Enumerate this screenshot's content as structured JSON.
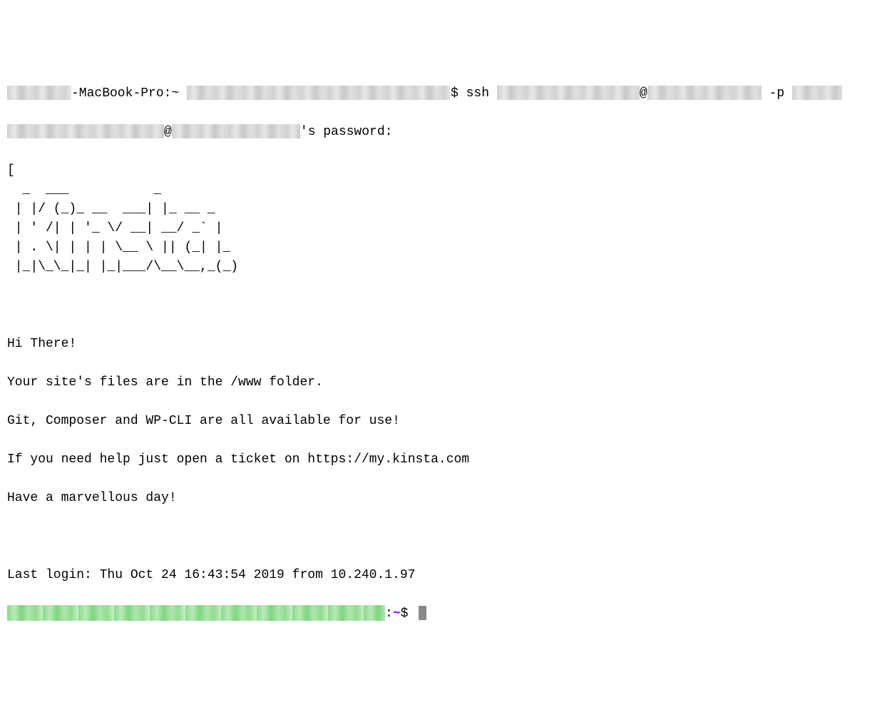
{
  "line1_p1": "-MacBook-Pro:~ ",
  "line1_p2": "$ ssh ",
  "line1_p3": "@",
  "line1_p4": " -p ",
  "line2_p1": "@",
  "line2_p2": "'s password:",
  "ascii_art": "[\n  _  ___           _\n | |/ (_)_ __  ___| |_ __ _\n | ' /| | '_ \\/ __| __/ _` |\n | . \\| | | | \\__ \\ || (_| |_\n |_|\\_\\_|_| |_|___/\\__\\__,_(_)",
  "motd_lines": [
    "Hi There!",
    "Your site's files are in the /www folder.",
    "Git, Composer and WP-CLI are all available for use!",
    "If you need help just open a ticket on https://my.kinsta.com",
    "Have a marvellous day!"
  ],
  "last_login": "Last login: Thu Oct 24 16:43:54 2019 from 10.240.1.97",
  "prompt_suffix": ":",
  "prompt_tilde": "~",
  "prompt_dollar": "$ "
}
